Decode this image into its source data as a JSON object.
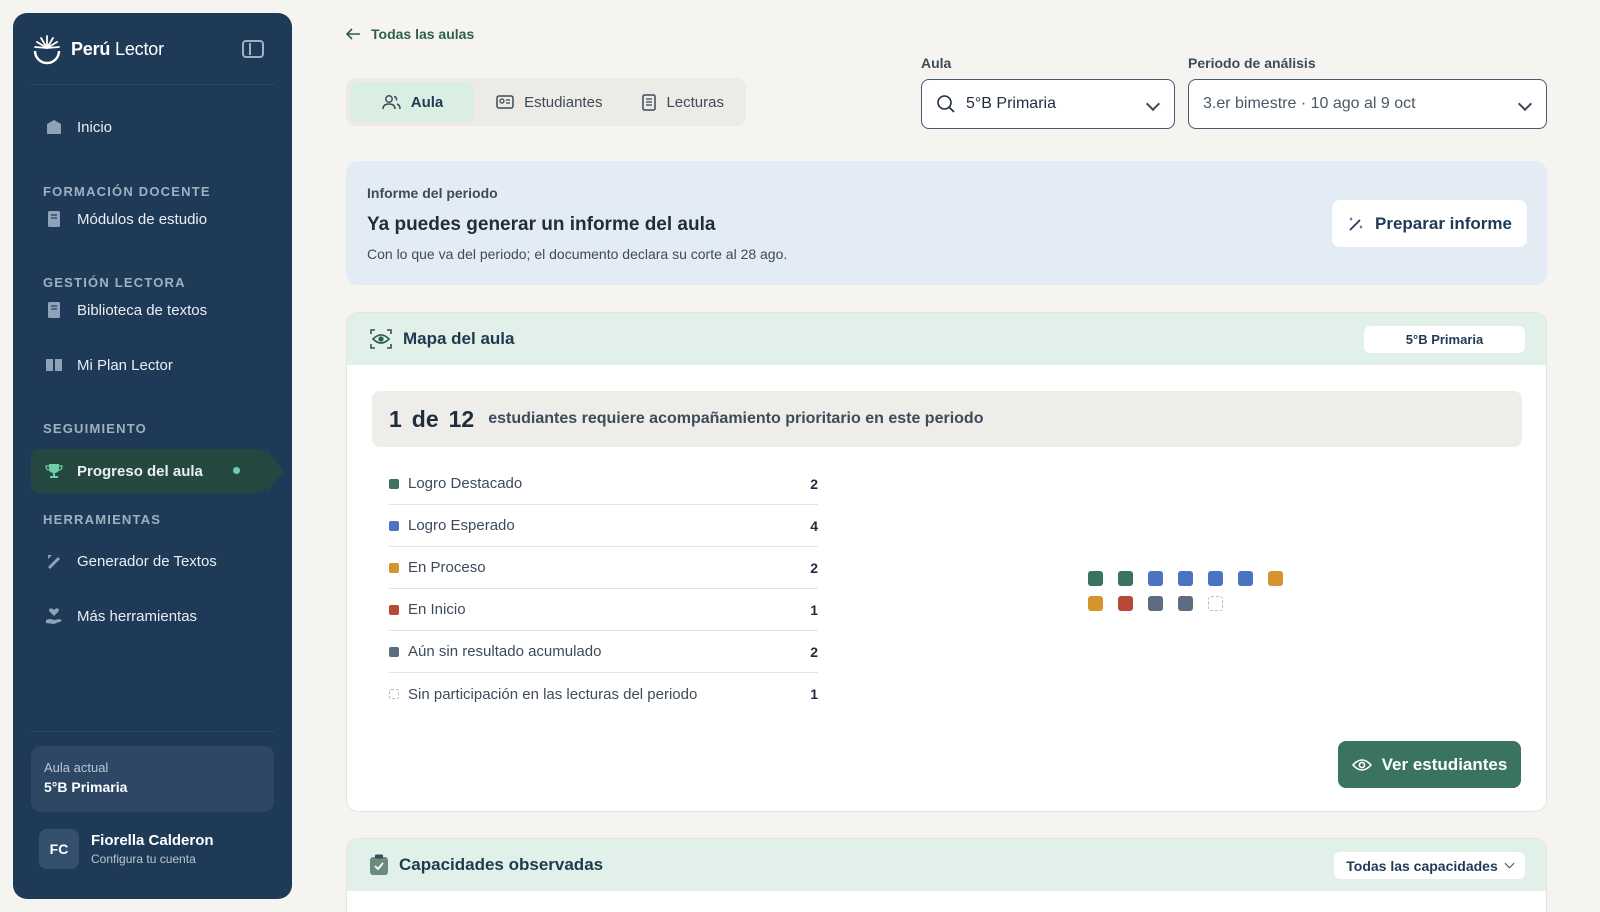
{
  "sidebar": {
    "brand_bold": "Perú",
    "brand_light": "Lector",
    "items": [
      {
        "label": "Inicio"
      },
      {
        "section": "FORMACIÓN DOCENTE"
      },
      {
        "label": "Módulos de estudio"
      },
      {
        "section": "GESTIÓN LECTORA"
      },
      {
        "label": "Biblioteca de textos"
      },
      {
        "label": "Mi Plan Lector"
      },
      {
        "section": "SEGUIMIENTO"
      },
      {
        "label": "Progreso del aula"
      },
      {
        "section": "HERRAMIENTAS"
      },
      {
        "label": "Generador de Textos"
      },
      {
        "label": "Más herramientas"
      }
    ],
    "current_class_label": "Aula actual",
    "current_class_value": "5°B Primaria",
    "user": {
      "initials": "FC",
      "name": "Fiorella Calderon",
      "subtitle": "Configura tu cuenta"
    }
  },
  "main": {
    "back_link": "Todas las aulas",
    "tabs": [
      "Aula",
      "Estudiantes",
      "Lecturas"
    ],
    "filters": {
      "aula_label": "Aula",
      "aula_value": "5°B Primaria",
      "period_label": "Periodo de análisis",
      "period_value": "3.er bimestre · 10 ago al 9 oct"
    },
    "report": {
      "kicker": "Informe del periodo",
      "title": "Ya puedes generar un informe del aula",
      "description": "Con lo que va del periodo; el documento declara su corte al 28 ago.",
      "button": "Preparar informe"
    },
    "map": {
      "title": "Mapa del aula",
      "chip": "5°B Primaria",
      "summary_count": "1",
      "summary_of": "de",
      "summary_total": "12",
      "summary_text": "estudiantes requiere acompañamiento prioritario en este periodo",
      "legend": [
        {
          "label": "Logro Destacado",
          "count": "2",
          "color": "#3b7361"
        },
        {
          "label": "Logro Esperado",
          "count": "4",
          "color": "#4a73c2"
        },
        {
          "label": "En Proceso",
          "count": "2",
          "color": "#d4952f"
        },
        {
          "label": "En Inicio",
          "count": "1",
          "color": "#b84a35"
        },
        {
          "label": "Aún sin resultado acumulado",
          "count": "2",
          "color": "#5d6d80"
        },
        {
          "label": "Sin participación en las lecturas del periodo",
          "count": "1",
          "color": "none"
        }
      ],
      "grid_colors": [
        "#3b7361",
        "#3b7361",
        "#4a73c2",
        "#4a73c2",
        "#4a73c2",
        "#4a73c2",
        "#d4952f",
        "#d4952f",
        "#b84a35",
        "#5d6d80",
        "#5d6d80",
        "none"
      ],
      "view_button": "Ver estudiantes"
    },
    "capacities": {
      "title": "Capacidades observadas",
      "filter": "Todas las capacidades"
    }
  }
}
